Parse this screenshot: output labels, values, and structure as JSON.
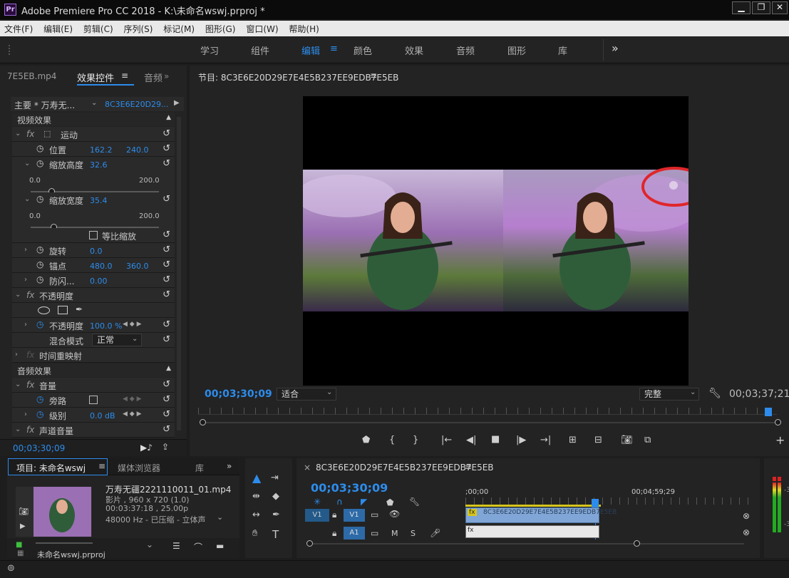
{
  "window": {
    "title": "Adobe Premiere Pro CC 2018 - K:\\未命名wswj.prproj *",
    "logo": "Pr",
    "controls": [
      "▁",
      "❐",
      "✕"
    ]
  },
  "menu": [
    "文件(F)",
    "编辑(E)",
    "剪辑(C)",
    "序列(S)",
    "标记(M)",
    "图形(G)",
    "窗口(W)",
    "帮助(H)"
  ],
  "workspaces": {
    "items": [
      "学习",
      "组件",
      "编辑",
      "颜色",
      "效果",
      "音频",
      "图形",
      "库"
    ],
    "active": "编辑",
    "more": "»"
  },
  "effect_controls": {
    "tabs": [
      "7E5EB.mp4",
      "效果控件",
      "音频"
    ],
    "master_label": "主要 * 万寿无...",
    "sequence_label": "8C3E6E20D29...",
    "video_effects_header": "视频效果",
    "motion": "运动",
    "position": {
      "label": "位置",
      "x": "162.2",
      "y": "240.0"
    },
    "scale_height": {
      "label": "缩放高度",
      "value": "32.6",
      "min": "0.0",
      "max": "200.0",
      "fraction": 0.163
    },
    "scale_width": {
      "label": "缩放宽度",
      "value": "35.4",
      "min": "0.0",
      "max": "200.0",
      "fraction": 0.177
    },
    "uniform_scale": "等比缩放",
    "rotation": {
      "label": "旋转",
      "value": "0.0"
    },
    "anchor": {
      "label": "锚点",
      "x": "480.0",
      "y": "360.0"
    },
    "anti_flicker": {
      "label": "防闪...",
      "value": "0.00"
    },
    "opacity_header": "不透明度",
    "opacity": {
      "label": "不透明度",
      "value": "100.0 %"
    },
    "blend_mode": {
      "label": "混合模式",
      "value": "正常"
    },
    "time_remap": "时间重映射",
    "audio_effects_header": "音频效果",
    "volume": "音量",
    "bypass": "旁路",
    "level": {
      "label": "级别",
      "value": "0.0 dB"
    },
    "channel_volume": "声道音量",
    "timecode": "00;03;30;09",
    "fx_symbol": "fx"
  },
  "program_monitor": {
    "title": "节目: 8C3E6E20D29E7E4E5B237EE9EDB7E5EB",
    "timecode": "00;03;30;09",
    "fit": "适合",
    "quality": "完整",
    "duration": "00;03;37;21"
  },
  "project": {
    "tabs": [
      "项目: 未命名wswj",
      "媒体浏览器",
      "库"
    ],
    "clip_name": "万寿无疆2221110011_01.mp4",
    "clip_info1": "影片 , 960 x 720 (1.0)",
    "clip_info2": "00:03:37:18 , 25.00p",
    "clip_info3": "48000 Hz - 已压缩 - 立体声",
    "footer": "未命名wswj.prproj"
  },
  "timeline": {
    "tab": "8C3E6E20D29E7E4E5B237EE9EDB7E5EB",
    "timecode": "00;03;30;09",
    "ruler": [
      ";00;00",
      "00;04;59;29"
    ],
    "v1": "V1",
    "a1": "A1",
    "m": "M",
    "s": "S",
    "clip_label": "8C3E6E20D29E7E4E5B237EE9EDB7E5EB"
  },
  "meter": {
    "labels": [
      "-3",
      "-3"
    ]
  },
  "colors": {
    "accent": "#2d8ceb",
    "bg": "#232323",
    "annotation": "#e0262a"
  }
}
